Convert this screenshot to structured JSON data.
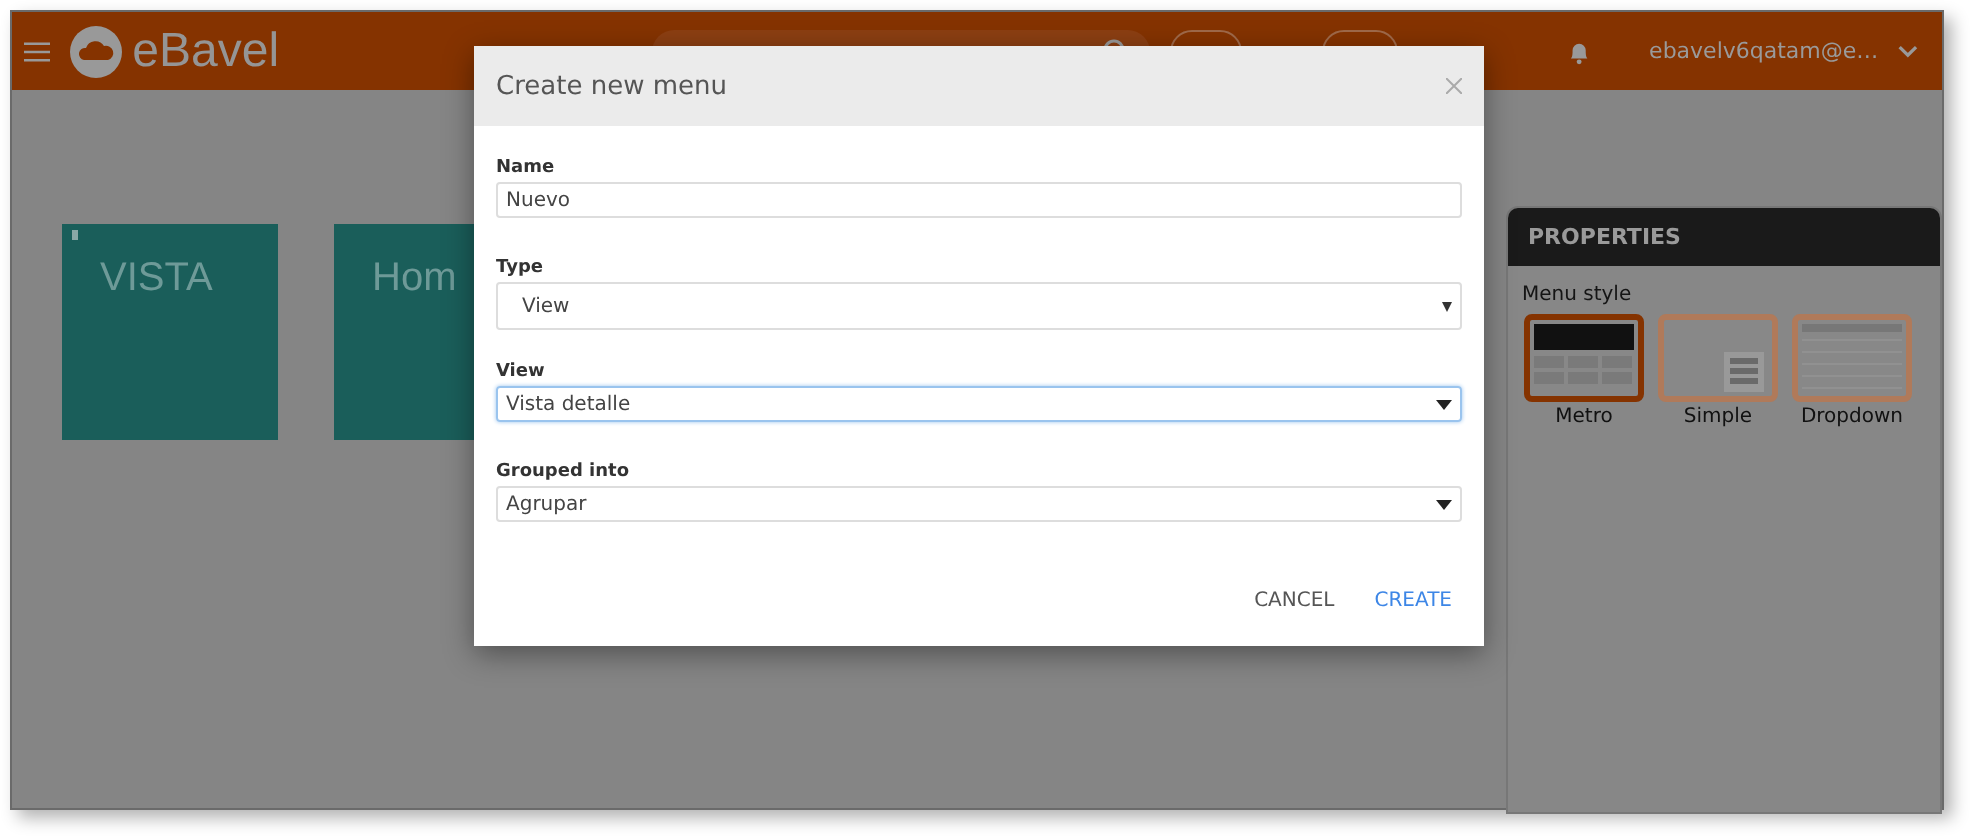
{
  "header": {
    "logo": "eBavel",
    "user": "ebavelv6qatam@e…"
  },
  "tiles": [
    {
      "label": "VISTA",
      "flagged": true
    },
    {
      "label": "Hom",
      "flagged": false
    }
  ],
  "properties": {
    "title": "PROPERTIES",
    "section": "Menu style",
    "styles": [
      {
        "label": "Metro",
        "kind": "metro",
        "selected": true
      },
      {
        "label": "Simple",
        "kind": "simple",
        "selected": false
      },
      {
        "label": "Dropdown",
        "kind": "dropdown",
        "selected": false
      }
    ]
  },
  "dialog": {
    "title": "Create new menu",
    "fields": [
      {
        "label": "Name",
        "kind": "text",
        "value": "Nuevo",
        "focused": false
      },
      {
        "label": "Type",
        "kind": "native-select",
        "value": "View",
        "focused": false
      },
      {
        "label": "View",
        "kind": "select",
        "value": "Vista detalle",
        "focused": true
      },
      {
        "label": "Grouped into",
        "kind": "select",
        "value": "Agrupar",
        "focused": false
      }
    ],
    "buttons": [
      {
        "label": "CANCEL",
        "kind": "secondary"
      },
      {
        "label": "CREATE",
        "kind": "primary"
      }
    ]
  }
}
